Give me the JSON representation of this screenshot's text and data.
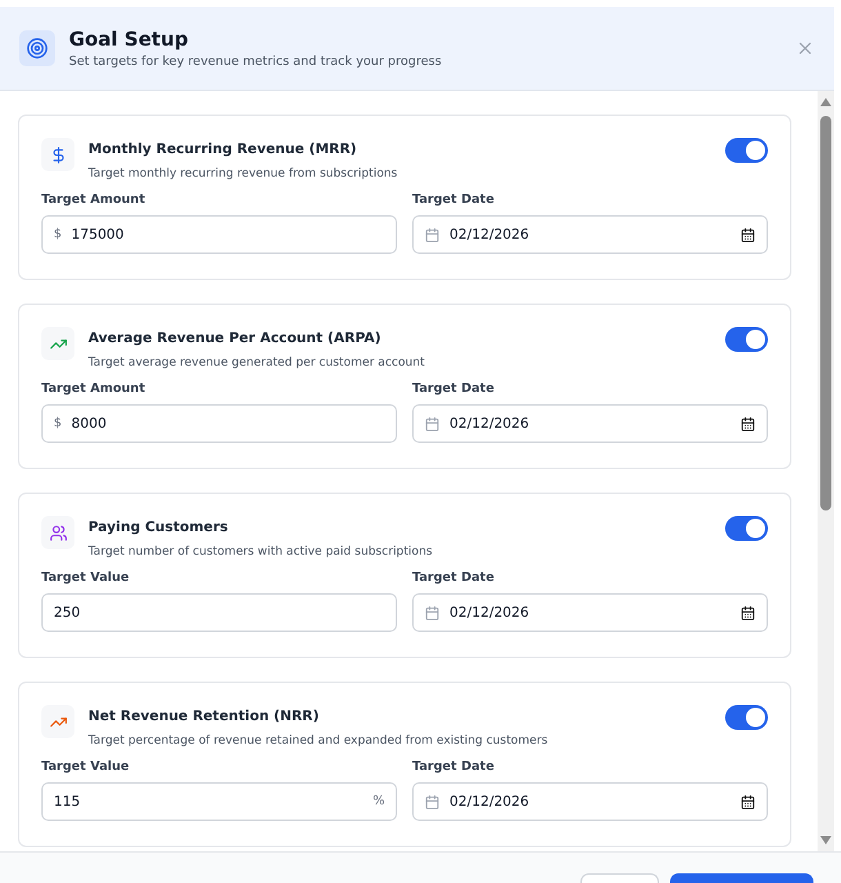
{
  "header": {
    "title": "Goal Setup",
    "subtitle": "Set targets for key revenue metrics and track your progress"
  },
  "goals": [
    {
      "title": "Monthly Recurring Revenue (MRR)",
      "description": "Target monthly recurring revenue from subscriptions",
      "enabled": true,
      "value_label": "Target Amount",
      "prefix": "$",
      "value": "175000",
      "date_label": "Target Date",
      "date": "02/12/2026"
    },
    {
      "title": "Average Revenue Per Account (ARPA)",
      "description": "Target average revenue generated per customer account",
      "enabled": true,
      "value_label": "Target Amount",
      "prefix": "$",
      "value": "8000",
      "date_label": "Target Date",
      "date": "02/12/2026"
    },
    {
      "title": "Paying Customers",
      "description": "Target number of customers with active paid subscriptions",
      "enabled": true,
      "value_label": "Target Value",
      "value": "250",
      "date_label": "Target Date",
      "date": "02/12/2026"
    },
    {
      "title": "Net Revenue Retention (NRR)",
      "description": "Target percentage of revenue retained and expanded from existing customers",
      "enabled": true,
      "value_label": "Target Value",
      "suffix": "%",
      "value": "115",
      "date_label": "Target Date",
      "date": "02/12/2026"
    }
  ]
}
